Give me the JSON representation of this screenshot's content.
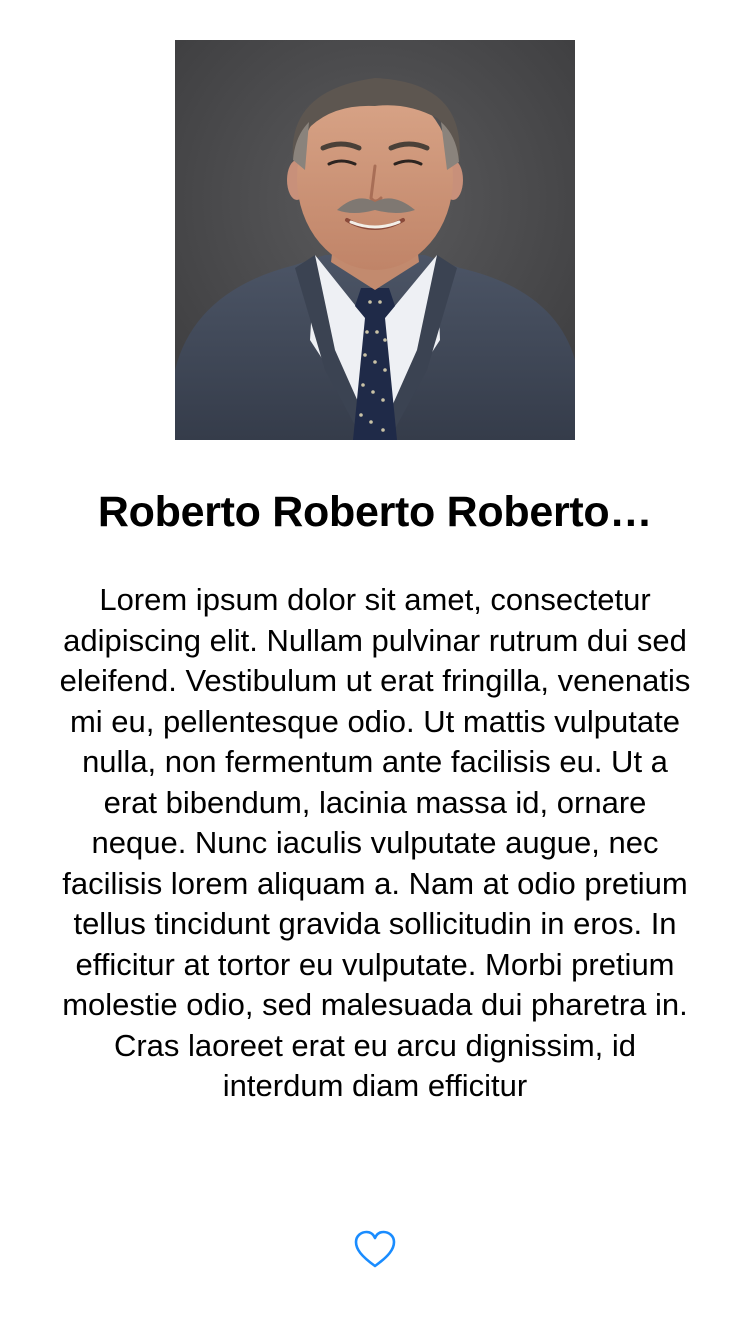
{
  "profile": {
    "name": "Roberto Roberto Roberto…",
    "bio": "Lorem ipsum dolor sit amet, consectetur adipiscing elit. Nullam pulvinar rutrum dui sed eleifend. Vestibulum ut erat fringilla, venenatis mi eu, pellentesque odio. Ut mattis vulputate nulla, non fermentum ante facilisis eu. Ut a erat bibendum, lacinia massa id, ornare neque. Nunc iaculis vulputate augue, nec facilisis lorem aliquam a. Nam at odio pretium tellus tincidunt gravida sollicitudin in eros. In efficitur at tortor eu vulputate. Morbi pretium molestie odio, sed malesuada dui pharetra in. Cras laoreet erat eu arcu dignissim, id interdum diam efficitur",
    "photo_icon": "person-portrait-photo"
  },
  "actions": {
    "like_icon": "heart-outline-icon",
    "accent_color": "#1a8cff"
  }
}
